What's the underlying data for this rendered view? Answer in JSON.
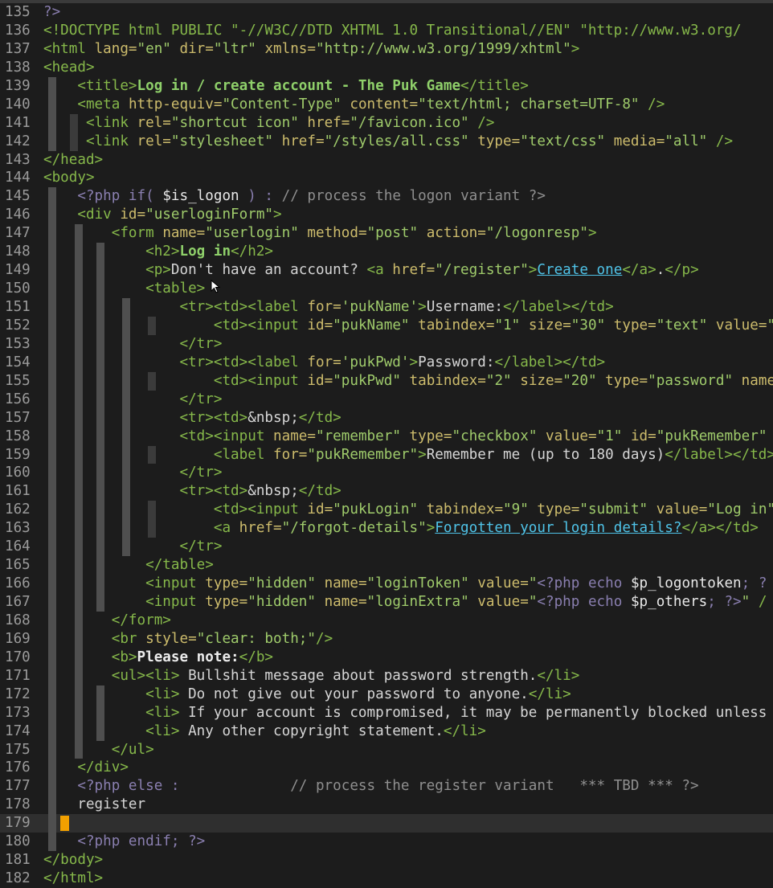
{
  "editor": {
    "cursor_line": 179,
    "lines": [
      {
        "n": "135",
        "g": [],
        "h": "<span class=\"p\">?></span>"
      },
      {
        "n": "136",
        "g": [],
        "h": "<span class=\"t\">&lt;!DOCTYPE html PUBLIC \"-//W3C//DTD XHTML 1.0 Transitional//EN\" \"http://www.w3.org/</span>"
      },
      {
        "n": "137",
        "g": [],
        "h": "<span class=\"t\">&lt;html</span> <span class=\"a\">lang=</span><span class=\"s\">\"en\"</span> <span class=\"a\">dir=</span><span class=\"s\">\"ltr\"</span> <span class=\"a\">xmlns=</span><span class=\"s\">\"http://www.w3.org/1999/xhtml\"</span><span class=\"t\">></span>"
      },
      {
        "n": "138",
        "g": [],
        "h": "<span class=\"t\">&lt;head></span>"
      },
      {
        "n": "139",
        "g": [
          0
        ],
        "h": "    <span class=\"t\">&lt;title></span><span class=\"tb\">Log in / create account - The Puk Game</span><span class=\"t\">&lt;/title></span>"
      },
      {
        "n": "140",
        "g": [
          0
        ],
        "h": "    <span class=\"t\">&lt;meta</span> <span class=\"a\">http-equiv=</span><span class=\"s\">\"Content-Type\"</span> <span class=\"a\">content=</span><span class=\"s\">\"text/html; charset=UTF-8\"</span> <span class=\"t\">/></span>"
      },
      {
        "n": "141",
        "g": [
          0,
          1
        ],
        "h": "     <span class=\"t\">&lt;link</span> <span class=\"a\">rel=</span><span class=\"s\">\"shortcut icon\"</span> <span class=\"a\">href=</span><span class=\"s\">\"/favicon.ico\"</span> <span class=\"t\">/></span>"
      },
      {
        "n": "142",
        "g": [
          0,
          1
        ],
        "h": "     <span class=\"t\">&lt;link</span> <span class=\"a\">rel=</span><span class=\"s\">\"stylesheet\"</span> <span class=\"a\">href=</span><span class=\"s\">\"/styles/all.css\"</span> <span class=\"a\">type=</span><span class=\"s\">\"text/css\"</span> <span class=\"a\">media=</span><span class=\"s\">\"all\"</span> <span class=\"t\">/></span>"
      },
      {
        "n": "143",
        "g": [],
        "h": "<span class=\"t\">&lt;/head></span>"
      },
      {
        "n": "144",
        "g": [],
        "h": "<span class=\"t\">&lt;body></span>"
      },
      {
        "n": "145",
        "g": [
          0
        ],
        "h": "    <span class=\"p\">&lt;?php if( </span><span class=\"v\">$is_logon</span><span class=\"p\"> ) : </span><span class=\"c\">// process the logon variant ?></span>"
      },
      {
        "n": "146",
        "g": [
          0
        ],
        "h": "    <span class=\"t\">&lt;div</span> <span class=\"a\">id=</span><span class=\"s\">\"userloginForm\"</span><span class=\"t\">></span>"
      },
      {
        "n": "147",
        "g": [
          0,
          2
        ],
        "h": "        <span class=\"t\">&lt;form</span> <span class=\"a\">name=</span><span class=\"s\">\"userlogin\"</span> <span class=\"a\">method=</span><span class=\"s\">\"post\"</span> <span class=\"a\">action=</span><span class=\"s\">\"/logonresp\"</span><span class=\"t\">></span>"
      },
      {
        "n": "148",
        "g": [
          0,
          2,
          3
        ],
        "h": "            <span class=\"t\">&lt;h2></span><span class=\"tb\">Log in</span><span class=\"t\">&lt;/h2></span>"
      },
      {
        "n": "149",
        "g": [
          0,
          2,
          3
        ],
        "h": "            <span class=\"t\">&lt;p></span>Don't have an account? <span class=\"t\">&lt;a</span> <span class=\"a\">href=</span><span class=\"s\">\"/register\"</span><span class=\"t\">></span><span class=\"lk\">Create one</span><span class=\"t\">&lt;/a></span>.<span class=\"t\">&lt;/p></span>"
      },
      {
        "n": "150",
        "g": [
          0,
          2,
          3
        ],
        "h": "            <span class=\"t\">&lt;table></span>"
      },
      {
        "n": "151",
        "g": [
          0,
          2,
          3,
          4
        ],
        "h": "                <span class=\"t\">&lt;tr>&lt;td>&lt;label</span> <span class=\"a\">for=</span><span class=\"s\">'pukName'</span><span class=\"t\">></span>Username:<span class=\"t\">&lt;/label>&lt;/td></span>"
      },
      {
        "n": "152",
        "g": [
          0,
          2,
          3,
          4,
          5
        ],
        "h": "                    <span class=\"t\">&lt;td>&lt;input</span> <span class=\"a\">id=</span><span class=\"s\">\"pukName\"</span> <span class=\"a\">tabindex=</span><span class=\"s\">\"1\"</span> <span class=\"a\">size=</span><span class=\"s\">\"30\"</span> <span class=\"a\">type=</span><span class=\"s\">\"text\"</span> <span class=\"a\">value=</span><span class=\"s\">\"&lt;</span>"
      },
      {
        "n": "153",
        "g": [
          0,
          2,
          3,
          4
        ],
        "h": "                <span class=\"t\">&lt;/tr></span>"
      },
      {
        "n": "154",
        "g": [
          0,
          2,
          3,
          4
        ],
        "h": "                <span class=\"t\">&lt;tr>&lt;td>&lt;label</span> <span class=\"a\">for=</span><span class=\"s\">'pukPwd'</span><span class=\"t\">></span>Password:<span class=\"t\">&lt;/label>&lt;/td></span>"
      },
      {
        "n": "155",
        "g": [
          0,
          2,
          3,
          4,
          5
        ],
        "h": "                    <span class=\"t\">&lt;td>&lt;input</span> <span class=\"a\">id=</span><span class=\"s\">\"pukPwd\"</span> <span class=\"a\">tabindex=</span><span class=\"s\">\"2\"</span> <span class=\"a\">size=</span><span class=\"s\">\"20\"</span> <span class=\"a\">type=</span><span class=\"s\">\"password\"</span> <span class=\"a\">name=</span>"
      },
      {
        "n": "156",
        "g": [
          0,
          2,
          3,
          4
        ],
        "h": "                <span class=\"t\">&lt;/tr></span>"
      },
      {
        "n": "157",
        "g": [
          0,
          2,
          3,
          4
        ],
        "h": "                <span class=\"t\">&lt;tr>&lt;td></span>&amp;nbsp;<span class=\"t\">&lt;/td></span>"
      },
      {
        "n": "158",
        "g": [
          0,
          2,
          3,
          4
        ],
        "h": "                <span class=\"t\">&lt;td>&lt;input</span> <span class=\"a\">name=</span><span class=\"s\">\"remember\"</span> <span class=\"a\">type=</span><span class=\"s\">\"checkbox\"</span> <span class=\"a\">value=</span><span class=\"s\">\"1\"</span> <span class=\"a\">id=</span><span class=\"s\">\"pukRemember\"</span>"
      },
      {
        "n": "159",
        "g": [
          0,
          2,
          3,
          4,
          5
        ],
        "h": "                    <span class=\"t\">&lt;label</span> <span class=\"a\">for=</span><span class=\"s\">\"pukRemember\"</span><span class=\"t\">></span>Remember me (up to 180 days)<span class=\"t\">&lt;/label>&lt;/td></span>"
      },
      {
        "n": "160",
        "g": [
          0,
          2,
          3,
          4
        ],
        "h": "                <span class=\"t\">&lt;/tr></span>"
      },
      {
        "n": "161",
        "g": [
          0,
          2,
          3,
          4
        ],
        "h": "                <span class=\"t\">&lt;tr>&lt;td></span>&amp;nbsp;<span class=\"t\">&lt;/td></span>"
      },
      {
        "n": "162",
        "g": [
          0,
          2,
          3,
          4,
          5
        ],
        "h": "                    <span class=\"t\">&lt;td>&lt;input</span> <span class=\"a\">id=</span><span class=\"s\">\"pukLogin\"</span> <span class=\"a\">tabindex=</span><span class=\"s\">\"9\"</span> <span class=\"a\">type=</span><span class=\"s\">\"submit\"</span> <span class=\"a\">value=</span><span class=\"s\">\"Log in\"</span>"
      },
      {
        "n": "163",
        "g": [
          0,
          2,
          3,
          4,
          5
        ],
        "h": "                    <span class=\"t\">&lt;a</span> <span class=\"a\">href=</span><span class=\"s\">\"/forgot-details\"</span><span class=\"t\">></span><span class=\"lk\">Forgotten your login details?</span><span class=\"t\">&lt;/a>&lt;/td></span>"
      },
      {
        "n": "164",
        "g": [
          0,
          2,
          3,
          4
        ],
        "h": "                <span class=\"t\">&lt;/tr></span>"
      },
      {
        "n": "165",
        "g": [
          0,
          2,
          3
        ],
        "h": "            <span class=\"t\">&lt;/table></span>"
      },
      {
        "n": "166",
        "g": [
          0,
          2,
          3
        ],
        "h": "            <span class=\"t\">&lt;input</span> <span class=\"a\">type=</span><span class=\"s\">\"hidden\"</span> <span class=\"a\">name=</span><span class=\"s\">\"loginToken\"</span> <span class=\"a\">value=</span><span class=\"s\">\"</span><span class=\"p\">&lt;?php echo </span><span class=\"v\">$p_logontoken</span><span class=\"p\">; ?</span>"
      },
      {
        "n": "167",
        "g": [
          0,
          2,
          3
        ],
        "h": "            <span class=\"t\">&lt;input</span> <span class=\"a\">type=</span><span class=\"s\">\"hidden\"</span> <span class=\"a\">name=</span><span class=\"s\">\"loginExtra\"</span> <span class=\"a\">value=</span><span class=\"s\">\"</span><span class=\"p\">&lt;?php echo </span><span class=\"v\">$p_others</span><span class=\"p\">; ?></span><span class=\"s\">\"</span> <span class=\"t\">/</span>"
      },
      {
        "n": "168",
        "g": [
          0,
          2
        ],
        "h": "        <span class=\"t\">&lt;/form></span>"
      },
      {
        "n": "169",
        "g": [
          0,
          2
        ],
        "h": "        <span class=\"t\">&lt;br</span> <span class=\"a\">style=</span><span class=\"s\">\"clear: both;\"</span><span class=\"t\">/></span>"
      },
      {
        "n": "170",
        "g": [
          0,
          2
        ],
        "h": "        <span class=\"t\">&lt;b></span><span class=\"b\">Please note:</span><span class=\"t\">&lt;/b></span>"
      },
      {
        "n": "171",
        "g": [
          0,
          2
        ],
        "h": "        <span class=\"t\">&lt;ul>&lt;li></span> Bullshit message about password strength.<span class=\"t\">&lt;/li></span>"
      },
      {
        "n": "172",
        "g": [
          0,
          2,
          3
        ],
        "h": "            <span class=\"t\">&lt;li></span> Do not give out your password to anyone.<span class=\"t\">&lt;/li></span>"
      },
      {
        "n": "173",
        "g": [
          0,
          2,
          3
        ],
        "h": "            <span class=\"t\">&lt;li></span> If your account is compromised, it may be permanently blocked unless"
      },
      {
        "n": "174",
        "g": [
          0,
          2,
          3
        ],
        "h": "            <span class=\"t\">&lt;li></span> Any other copyright statement.<span class=\"t\">&lt;/li></span>"
      },
      {
        "n": "175",
        "g": [
          0,
          2
        ],
        "h": "        <span class=\"t\">&lt;/ul></span>"
      },
      {
        "n": "176",
        "g": [
          0
        ],
        "h": "    <span class=\"t\">&lt;/div></span>"
      },
      {
        "n": "177",
        "g": [
          0
        ],
        "h": "    <span class=\"p\">&lt;?php else :             </span><span class=\"c\">// process the register variant   *** TBD *** ?></span>"
      },
      {
        "n": "178",
        "g": [
          0
        ],
        "h": "    register"
      },
      {
        "n": "179",
        "g": [
          0
        ],
        "h": ""
      },
      {
        "n": "180",
        "g": [
          0
        ],
        "h": "    <span class=\"p\">&lt;?php endif; ?></span>"
      },
      {
        "n": "181",
        "g": [],
        "h": "<span class=\"t\">&lt;/body></span>"
      },
      {
        "n": "182",
        "g": [],
        "h": "<span class=\"t\">&lt;/html></span>"
      }
    ]
  },
  "colors": {
    "background": "#1c1c1c",
    "cursor": "#f2a000",
    "tag": "#86b84a",
    "attribute": "#cdbc6c",
    "string": "#9fcb6b",
    "link": "#4fc3e8"
  }
}
